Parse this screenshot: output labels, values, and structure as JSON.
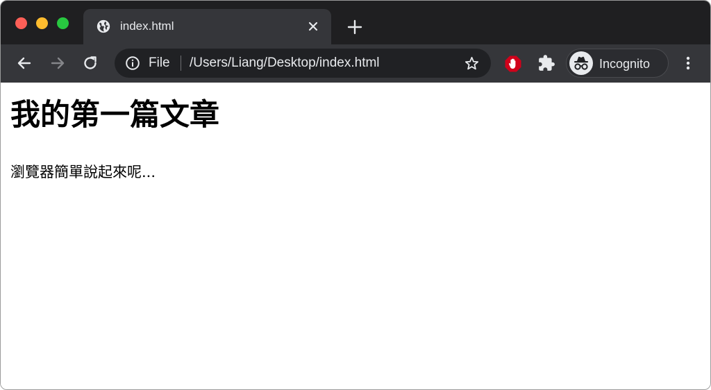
{
  "window": {
    "traffic_lights": {
      "close_color": "#fe5f57",
      "minimize_color": "#febc2e",
      "maximize_color": "#28c840"
    }
  },
  "tabs": [
    {
      "title": "index.html",
      "favicon": "globe-icon",
      "active": true
    }
  ],
  "toolbar": {
    "omnibox": {
      "scheme_label": "File",
      "url": "/Users/Liang/Desktop/index.html"
    },
    "incognito_label": "Incognito",
    "icons": {
      "back": "arrow-left-icon",
      "forward": "arrow-right-icon",
      "reload": "reload-icon",
      "info": "info-icon",
      "bookmark": "star-icon",
      "extension_blocker": "stop-hand-icon",
      "extensions": "puzzle-icon",
      "profile": "incognito-icon",
      "menu": "vertical-dots-icon"
    }
  },
  "page": {
    "heading": "我的第一篇文章",
    "paragraph": "瀏覽器簡單說起來呢..."
  },
  "colors": {
    "tabstrip_bg": "#1f1f21",
    "toolbar_bg": "#35363a",
    "omnibox_bg": "#202124",
    "text_light": "#e8eaed",
    "extension_red": "#d0021b"
  }
}
